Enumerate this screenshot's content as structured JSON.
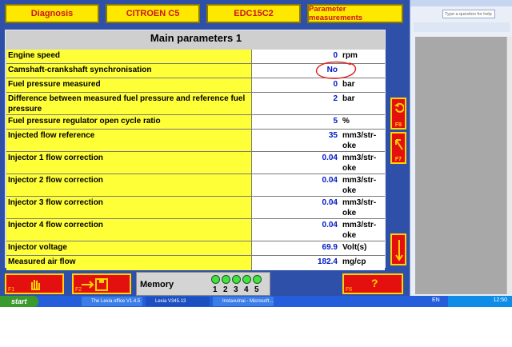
{
  "tabs": [
    "Diagnosis",
    "CITROEN C5",
    "EDC15C2",
    "Parameter measurements"
  ],
  "panel_title": "Main parameters 1",
  "rows": [
    {
      "label": "Engine speed",
      "value": "0",
      "unit": "rpm"
    },
    {
      "label": "Camshaft-crankshaft synchronisation",
      "value": "No",
      "unit": ""
    },
    {
      "label": "Fuel pressure measured",
      "value": "0",
      "unit": "bar"
    },
    {
      "label": "Difference between measured fuel pressure and reference fuel pressure",
      "value": "2",
      "unit": "bar"
    },
    {
      "label": "Fuel pressure regulator open cycle ratio",
      "value": "5",
      "unit": "%"
    },
    {
      "label": "Injected flow reference",
      "value": "35",
      "unit": "mm3/str-oke"
    },
    {
      "label": "Injector 1 flow correction",
      "value": "0.04",
      "unit": "mm3/str-oke"
    },
    {
      "label": "Injector 2 flow correction",
      "value": "0.04",
      "unit": "mm3/str-oke"
    },
    {
      "label": "Injector 3 flow correction",
      "value": "0.04",
      "unit": "mm3/str-oke"
    },
    {
      "label": "Injector 4 flow correction",
      "value": "0.04",
      "unit": "mm3/str-oke"
    },
    {
      "label": "Injector  voltage",
      "value": "69.9",
      "unit": "Volt(s)"
    },
    {
      "label": "Measured air flow",
      "value": "182.4",
      "unit": "mg/cp"
    }
  ],
  "side_buttons": {
    "f9": "F9",
    "f7": "F7"
  },
  "bottom": {
    "f1": "F1",
    "f2": "F2",
    "f6": "F6",
    "help": "?",
    "memory_label": "Memory",
    "slots": [
      "1",
      "2",
      "3",
      "4",
      "5"
    ]
  },
  "word_panel": {
    "search_placeholder": "Type a question for help"
  },
  "taskbar": {
    "start": "start",
    "tasks": [
      "The Lexia office V1.4.5",
      "Lexia V345.13",
      "Instavulnai - Microsoft..."
    ],
    "lang": "EN",
    "clock": "12:50"
  },
  "colors": {
    "app_bg": "#2e50a8",
    "label_bg": "#ffff38",
    "value_blue": "#0018c8",
    "button_red": "#e41010",
    "annotation_red": "#e02020"
  }
}
